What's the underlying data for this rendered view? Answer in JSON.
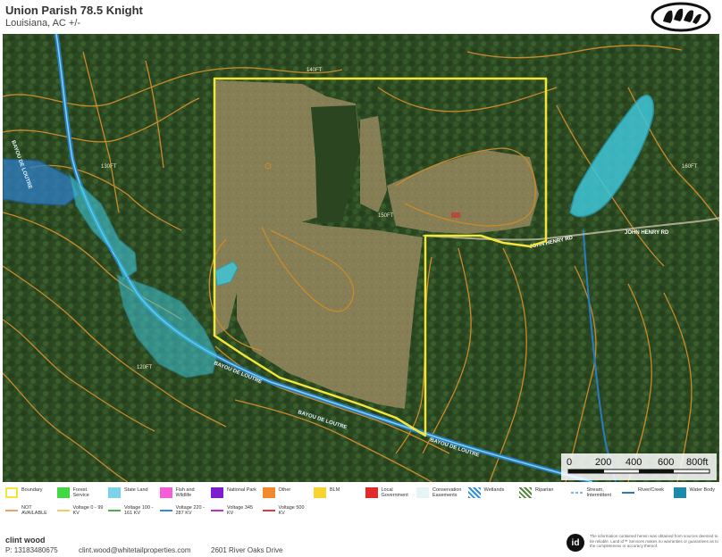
{
  "header": {
    "title": "Union Parish 78.5 Knight",
    "subtitle": "Louisiana,  AC +/-"
  },
  "map": {
    "contour_labels": [
      "140FT",
      "130FT",
      "150FT",
      "120FT",
      "160FT"
    ],
    "road_labels": [
      "JOHN HENRY RD",
      "JOHN HENRY RD"
    ],
    "water_labels": [
      "BAYOU DE LOUTRE",
      "BAYOU DE LOUTRE",
      "BAYOU DE LOUTRE",
      "BAYOU DE LOUTRE"
    ],
    "colors": {
      "boundary": "#f2e63a",
      "contour": "#c98a2a",
      "water_body": "#3fc6d9",
      "river": "#2a7bc4",
      "forest": "#2c4a22",
      "field": "#8a8454"
    }
  },
  "scale": {
    "ticks": [
      "0",
      "200",
      "400",
      "600",
      "800ft"
    ]
  },
  "legend": {
    "row1": [
      {
        "label": "Boundary",
        "color": "#f2e63a",
        "kind": "boundary"
      },
      {
        "label": "Forest Service",
        "color": "#43d843",
        "kind": "swatch"
      },
      {
        "label": "State Land",
        "color": "#7ad3e8",
        "kind": "swatch"
      },
      {
        "label": "Fish and Wildlife",
        "color": "#f45ed6",
        "kind": "swatch"
      },
      {
        "label": "National Park",
        "color": "#7a1fd0",
        "kind": "swatch"
      },
      {
        "label": "Other",
        "color": "#f08a2c",
        "kind": "swatch"
      },
      {
        "label": "BLM",
        "color": "#f7d52e",
        "kind": "swatch"
      },
      {
        "label": "Local Government",
        "color": "#e22a2a",
        "kind": "swatch"
      },
      {
        "label": "Conservation Easements",
        "color": "#e6f4f5",
        "kind": "swatch"
      },
      {
        "label": "Wetlands",
        "color": "#2f8fd6",
        "kind": "pattern"
      },
      {
        "label": "Riparian",
        "color": "#4f8a3c",
        "kind": "pattern"
      },
      {
        "label": "Stream, Intermittent",
        "color": "#7fb4e0",
        "kind": "dash"
      },
      {
        "label": "River/Creek",
        "color": "#2a7bc4",
        "kind": "line"
      },
      {
        "label": "Water Body",
        "color": "#1d8aa8",
        "kind": "swatch"
      }
    ],
    "row2": [
      {
        "label": "NOT AVAILABLE",
        "color": "#f2a06e",
        "kind": "line"
      },
      {
        "label": "Voltage 0 - 99 KV",
        "color": "#f2c76e",
        "kind": "line"
      },
      {
        "label": "Voltage 100 - 161 KV",
        "color": "#4ab04a",
        "kind": "line"
      },
      {
        "label": "Voltage 220 - 287 KV",
        "color": "#2f8fd6",
        "kind": "line"
      },
      {
        "label": "Voltage 345 KV",
        "color": "#c02fc0",
        "kind": "line"
      },
      {
        "label": "Voltage 500 KV",
        "color": "#e03a3a",
        "kind": "line"
      }
    ]
  },
  "footer": {
    "agent_name": "clint wood",
    "phone": "P: 13183480675",
    "email": "clint.wood@whitetailproperties.com",
    "address": "2601 River Oaks Drive",
    "id_logo": "id",
    "disclaimer": "The information contained herein was obtained from sources deemed to be reliable. Land id™ Services makes no warranties or guarantees as to the completeness or accuracy thereof."
  }
}
